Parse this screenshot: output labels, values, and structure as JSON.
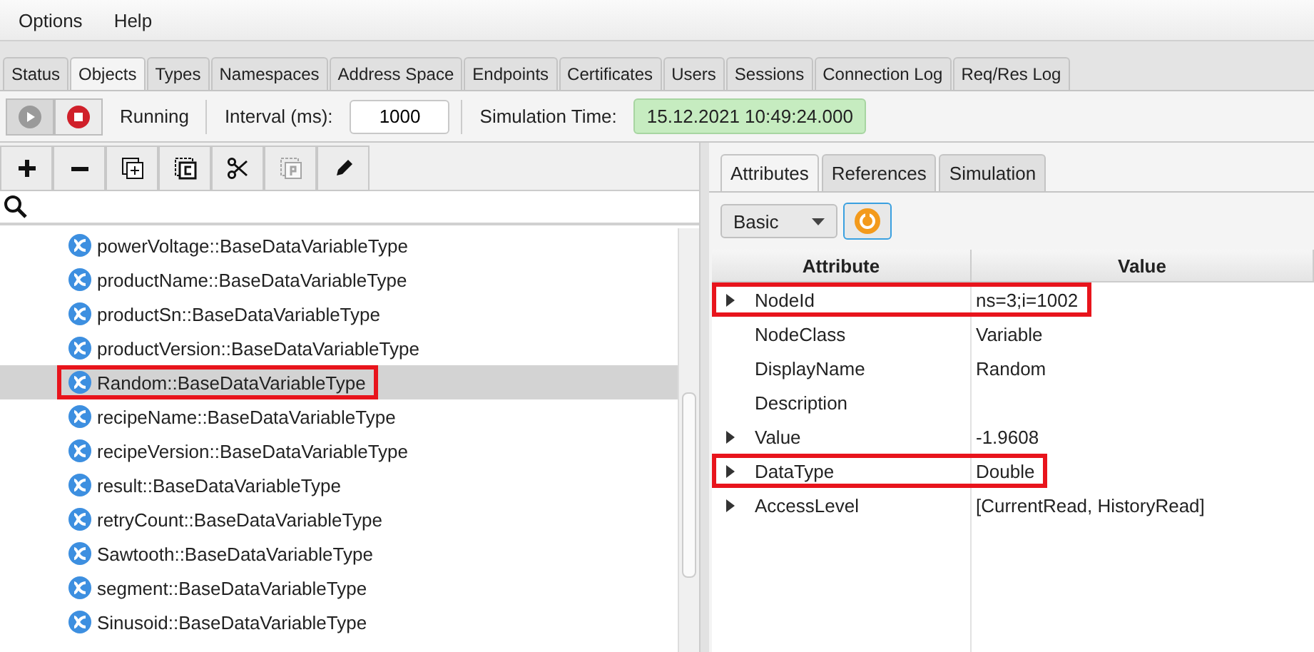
{
  "menu": [
    "Options",
    "Help"
  ],
  "tabs": [
    {
      "label": "Status",
      "selected": false
    },
    {
      "label": "Objects",
      "selected": true
    },
    {
      "label": "Types",
      "selected": false
    },
    {
      "label": "Namespaces",
      "selected": false
    },
    {
      "label": "Address Space",
      "selected": false
    },
    {
      "label": "Endpoints",
      "selected": false
    },
    {
      "label": "Certificates",
      "selected": false
    },
    {
      "label": "Users",
      "selected": false
    },
    {
      "label": "Sessions",
      "selected": false
    },
    {
      "label": "Connection Log",
      "selected": false
    },
    {
      "label": "Req/Res Log",
      "selected": false
    }
  ],
  "simulation": {
    "play_disabled": true,
    "state": "Running",
    "interval_label": "Interval (ms):",
    "interval": "1000",
    "time_label": "Simulation Time:",
    "time": "15.12.2021 10:49:24.000"
  },
  "tools": [
    {
      "kind": "add",
      "disabled": false
    },
    {
      "kind": "remove",
      "disabled": false
    },
    {
      "kind": "copy-add",
      "disabled": false
    },
    {
      "kind": "copy",
      "disabled": false
    },
    {
      "kind": "cut",
      "disabled": false
    },
    {
      "kind": "paste",
      "disabled": true
    },
    {
      "kind": "edit",
      "disabled": false
    }
  ],
  "tree": [
    {
      "label": "powerVoltage::BaseDataVariableType",
      "selected": false,
      "highlighted": false
    },
    {
      "label": "productName::BaseDataVariableType",
      "selected": false,
      "highlighted": false
    },
    {
      "label": "productSn::BaseDataVariableType",
      "selected": false,
      "highlighted": false
    },
    {
      "label": "productVersion::BaseDataVariableType",
      "selected": false,
      "highlighted": false
    },
    {
      "label": "Random::BaseDataVariableType",
      "selected": true,
      "highlighted": true
    },
    {
      "label": "recipeName::BaseDataVariableType",
      "selected": false,
      "highlighted": false
    },
    {
      "label": "recipeVersion::BaseDataVariableType",
      "selected": false,
      "highlighted": false
    },
    {
      "label": "result::BaseDataVariableType",
      "selected": false,
      "highlighted": false
    },
    {
      "label": "retryCount::BaseDataVariableType",
      "selected": false,
      "highlighted": false
    },
    {
      "label": "Sawtooth::BaseDataVariableType",
      "selected": false,
      "highlighted": false
    },
    {
      "label": "segment::BaseDataVariableType",
      "selected": false,
      "highlighted": false
    },
    {
      "label": "Sinusoid::BaseDataVariableType",
      "selected": false,
      "highlighted": false
    }
  ],
  "detail_tabs": [
    {
      "label": "Attributes",
      "selected": true
    },
    {
      "label": "References",
      "selected": false
    },
    {
      "label": "Simulation",
      "selected": false
    }
  ],
  "view_select": "Basic",
  "table": {
    "columns": [
      "Attribute",
      "Value"
    ],
    "rows": [
      {
        "attribute": "NodeId",
        "value": "ns=3;i=1002",
        "expandable": true,
        "highlighted": true
      },
      {
        "attribute": "NodeClass",
        "value": "Variable",
        "expandable": false,
        "highlighted": false
      },
      {
        "attribute": "DisplayName",
        "value": "Random",
        "expandable": false,
        "highlighted": false
      },
      {
        "attribute": "Description",
        "expandable": false,
        "highlighted": false
      },
      {
        "attribute": "Value",
        "value": "-1.9608",
        "expandable": true,
        "highlighted": false
      },
      {
        "attribute": "DataType",
        "value": "Double",
        "expandable": true,
        "highlighted": true
      },
      {
        "attribute": "AccessLevel",
        "value": "[CurrentRead, HistoryRead]",
        "expandable": true,
        "highlighted": false
      }
    ]
  }
}
